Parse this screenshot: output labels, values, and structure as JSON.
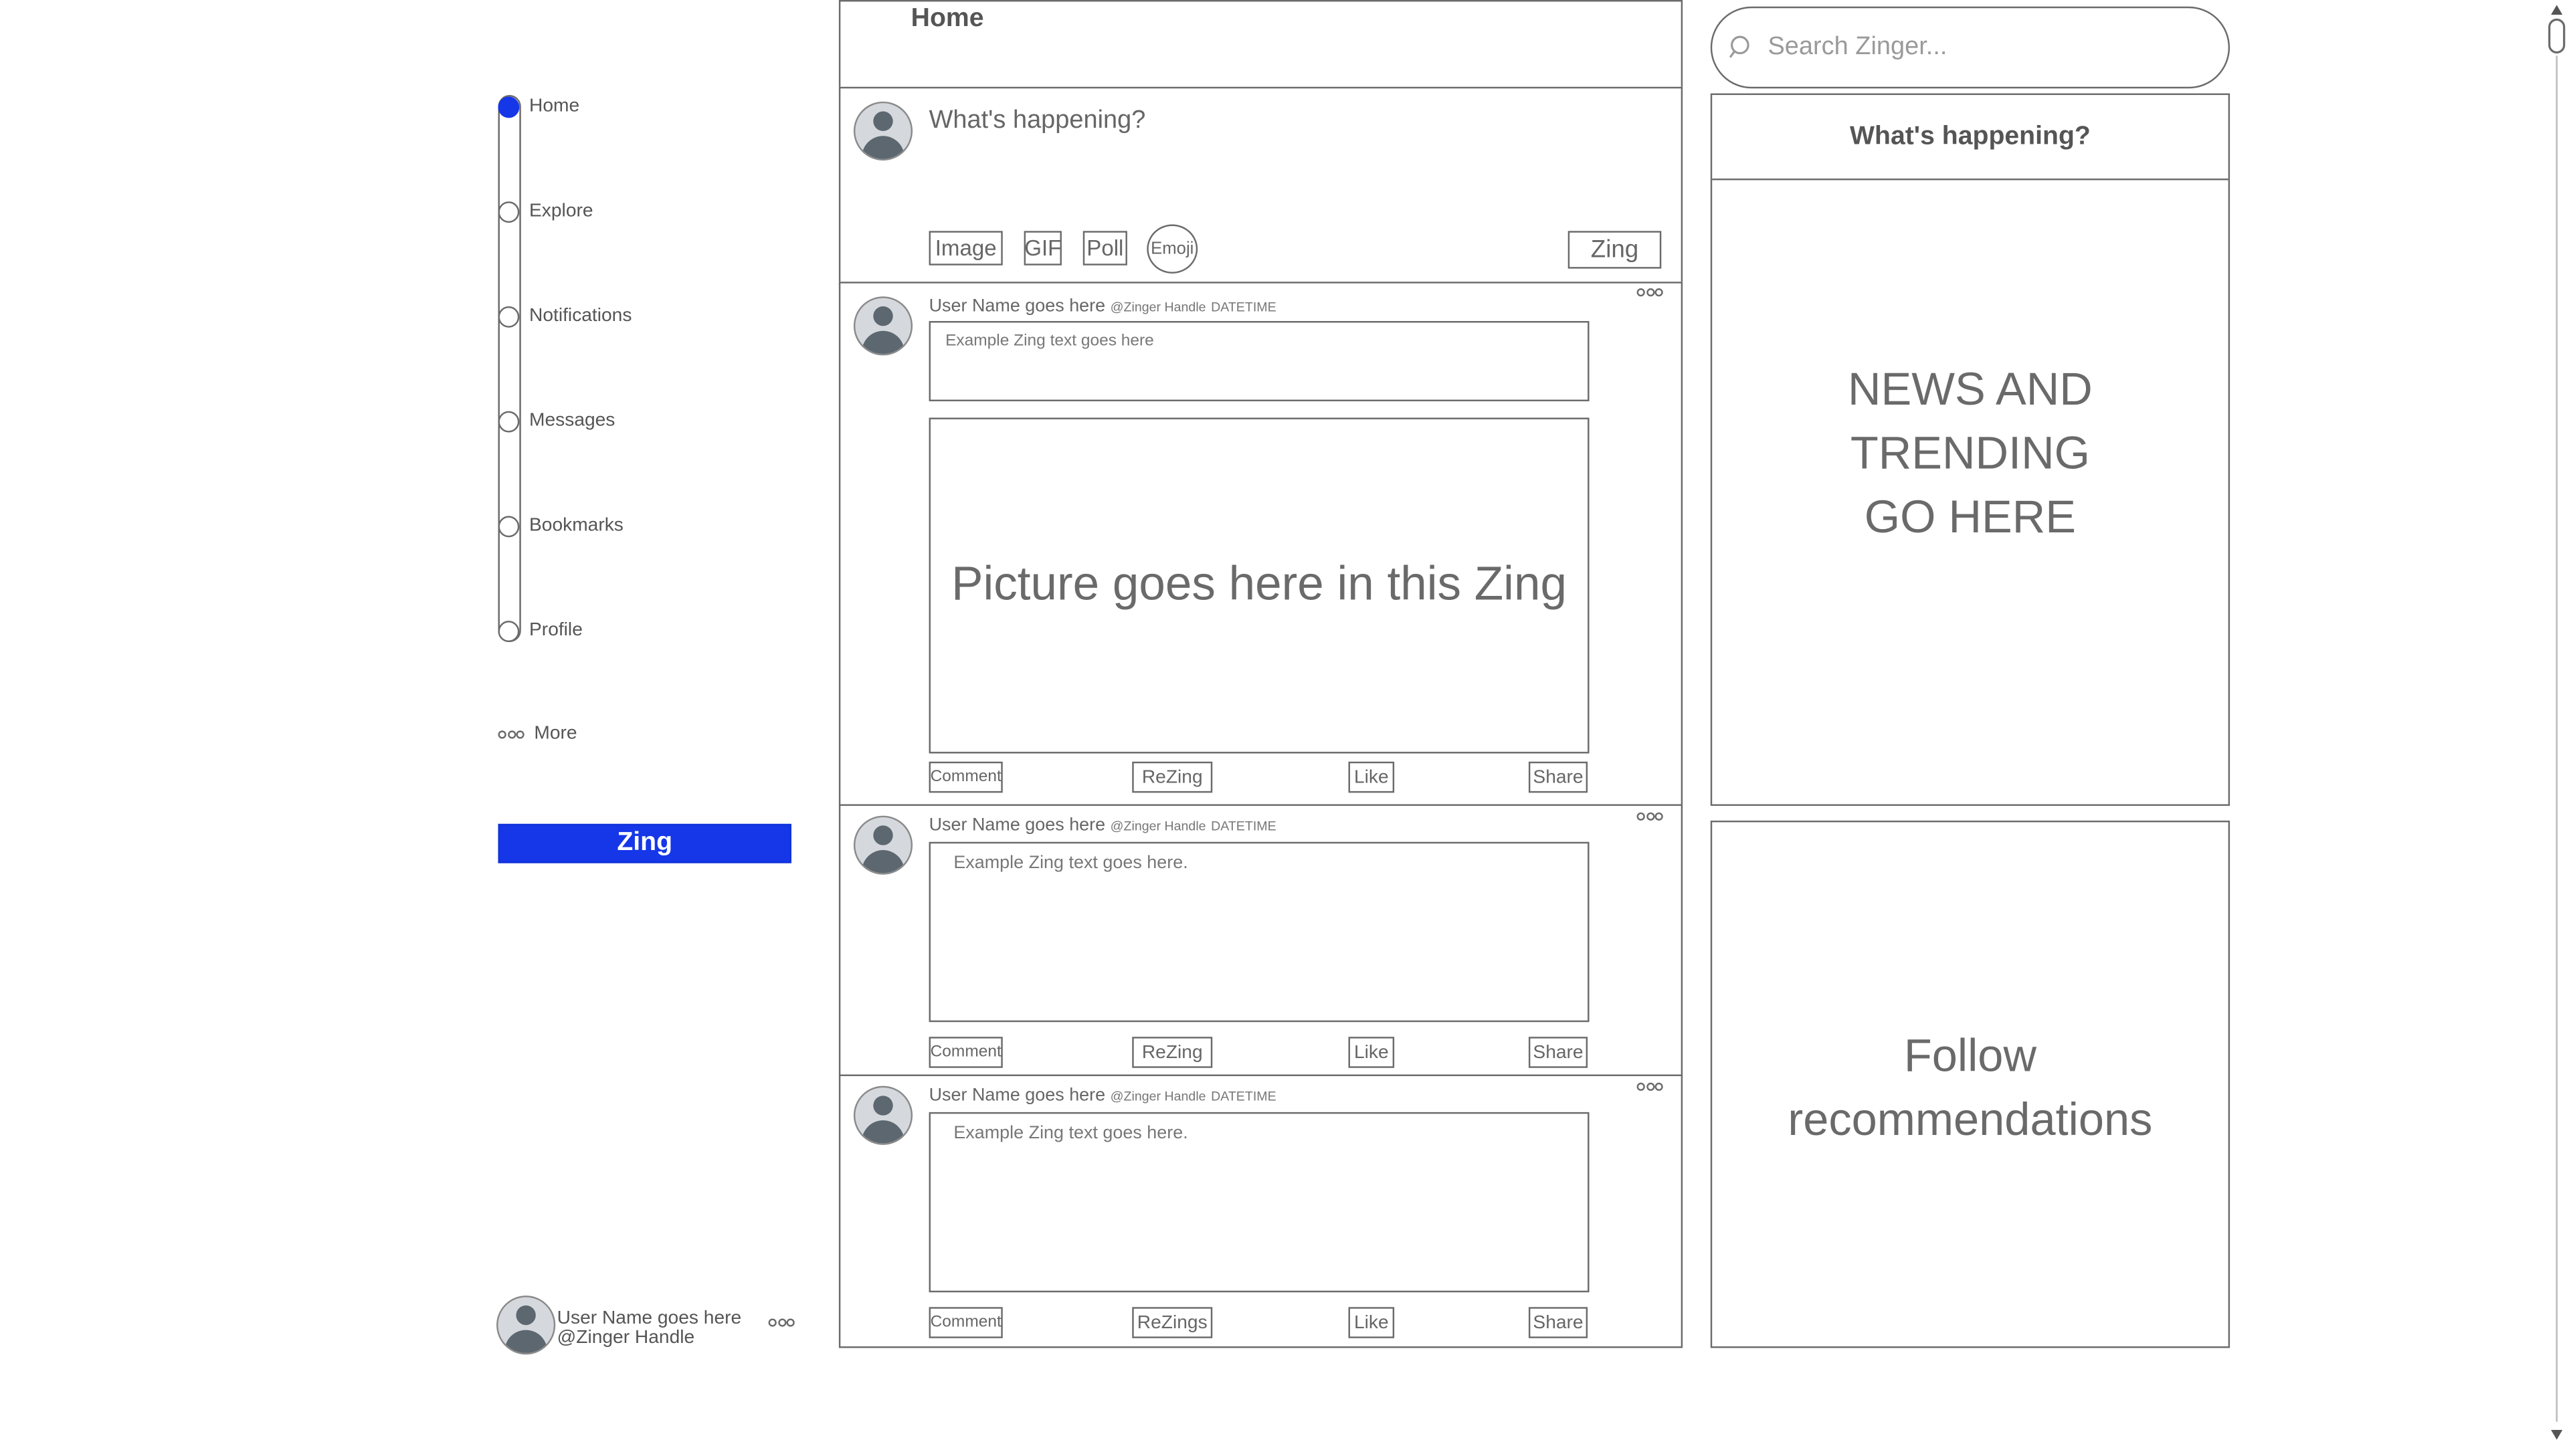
{
  "nav": {
    "items": [
      {
        "label": "Home"
      },
      {
        "label": "Explore"
      },
      {
        "label": "Notifications"
      },
      {
        "label": "Messages"
      },
      {
        "label": "Bookmarks"
      },
      {
        "label": "Profile"
      }
    ],
    "more_label": "More",
    "zing_button": "Zing",
    "user": {
      "name": "User Name goes here",
      "handle": "@Zinger Handle"
    }
  },
  "header": {
    "title": "Home"
  },
  "composer": {
    "placeholder": "What's happening?",
    "buttons": {
      "image": "Image",
      "gif": "GIF",
      "poll": "Poll",
      "emoji": "Emoji"
    },
    "zing_button": "Zing"
  },
  "posts": [
    {
      "user": "User Name goes here",
      "handle": "@Zinger Handle",
      "datetime": "DATETIME",
      "text": "Example Zing text goes here",
      "picture": "Picture goes here in this Zing",
      "actions": {
        "comment": "Comment",
        "rezing": "ReZing",
        "like": "Like",
        "share": "Share"
      }
    },
    {
      "user": "User Name goes here",
      "handle": "@Zinger Handle",
      "datetime": "DATETIME",
      "text": "Example Zing text goes here.",
      "actions": {
        "comment": "Comment",
        "rezing": "ReZing",
        "like": "Like",
        "share": "Share"
      }
    },
    {
      "user": "User Name goes here",
      "handle": "@Zinger Handle",
      "datetime": "DATETIME",
      "text": "Example Zing text goes here.",
      "actions": {
        "comment": "Comment",
        "rezing": "ReZings",
        "like": "Like",
        "share": "Share"
      }
    }
  ],
  "search": {
    "placeholder": "Search Zinger..."
  },
  "trending": {
    "title": "What's happening?",
    "body": [
      "NEWS AND",
      "TRENDING",
      "GO HERE"
    ]
  },
  "follow": {
    "body": [
      "Follow",
      "recommendations"
    ]
  },
  "colors": {
    "accent": "#1637e8",
    "outline": "#6b6b6b",
    "avatar_fill": "#d5d9de"
  },
  "icons": [
    "search-icon",
    "more-icon",
    "avatar-icon"
  ]
}
